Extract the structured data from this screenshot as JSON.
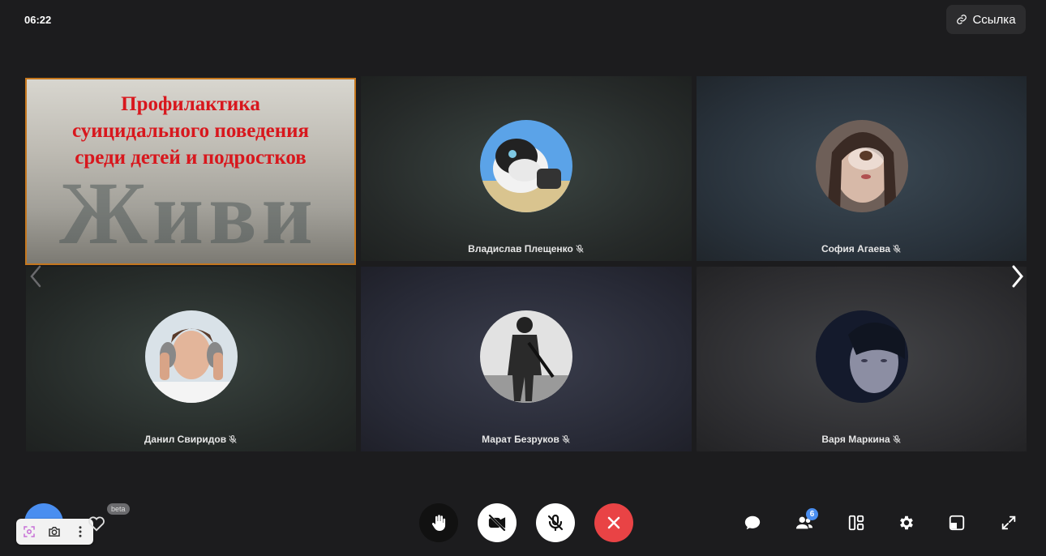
{
  "header": {
    "timer": "06:22",
    "link_label": "Ссылка"
  },
  "screen_share": {
    "title_lines": [
      "Профилактика",
      "суицидального поведения",
      "среди детей и подростков"
    ],
    "word": "Живи"
  },
  "participants": [
    {
      "name": "Владислав Плещенко",
      "muted": true
    },
    {
      "name": "София Агаева",
      "muted": true
    },
    {
      "name": "Данил Свиридов",
      "muted": true
    },
    {
      "name": "Марат Безруков",
      "muted": true
    },
    {
      "name": "Варя Маркина",
      "muted": true
    }
  ],
  "toolbar": {
    "participants_count": "6",
    "beta_label": "beta"
  },
  "colors": {
    "background": "#1c1c1e",
    "accent": "#4a8ef0",
    "end_call": "#e94345",
    "share_title": "#d8171d"
  },
  "icons": [
    "link-icon",
    "mic-off-icon",
    "chevron-left-icon",
    "chevron-right-icon",
    "raise-hand-icon",
    "video-off-icon",
    "end-call-icon",
    "chat-icon",
    "participants-icon",
    "layout-icon",
    "settings-icon",
    "pip-icon",
    "fullscreen-icon"
  ]
}
